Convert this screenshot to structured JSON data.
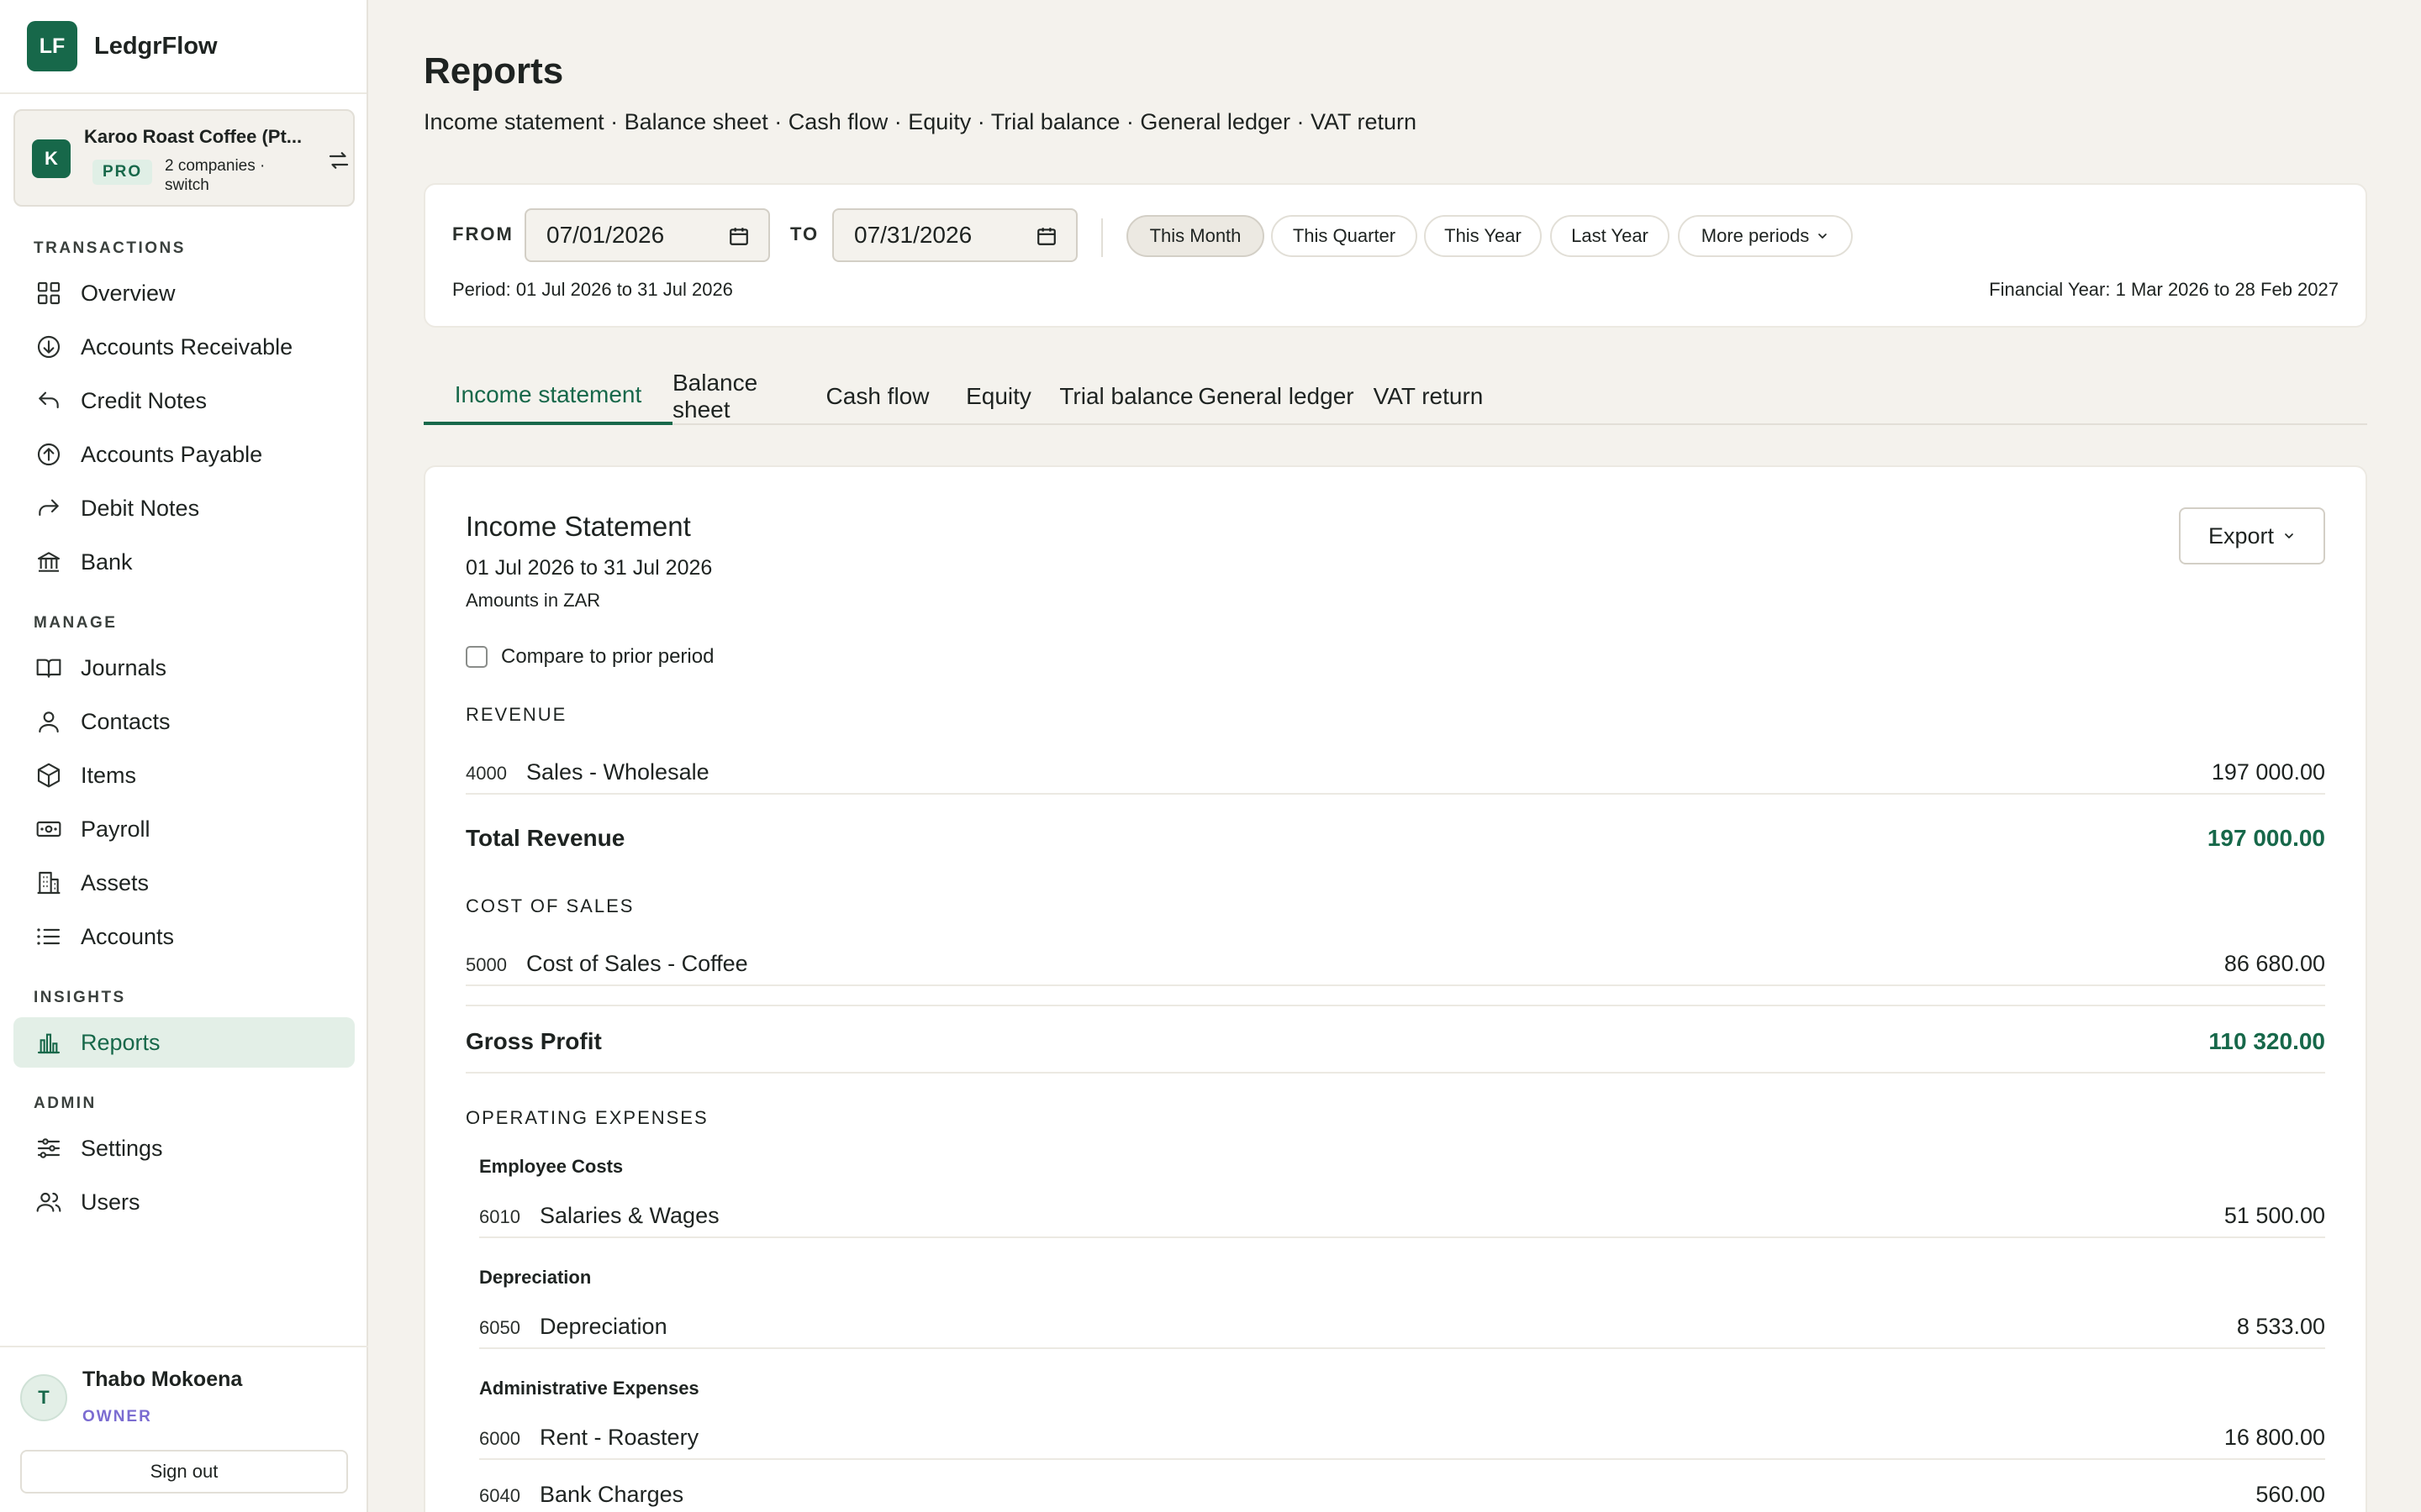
{
  "brand": {
    "logo": "LF",
    "name": "LedgrFlow"
  },
  "company": {
    "avatar": "K",
    "name": "Karoo Roast Coffee (Pt...",
    "plan": "PRO",
    "sub": "2 companies · switch",
    "icon": "switch-arrows-icon"
  },
  "nav": {
    "sections": {
      "transactions": "TRANSACTIONS",
      "manage": "MANAGE",
      "insights": "INSIGHTS",
      "admin": "ADMIN"
    },
    "items": [
      {
        "label": "Overview",
        "icon": "grid-icon"
      },
      {
        "label": "Accounts Receivable",
        "icon": "arrow-down-circle-icon"
      },
      {
        "label": "Credit Notes",
        "icon": "undo-arrow-icon"
      },
      {
        "label": "Accounts Payable",
        "icon": "arrow-up-circle-icon"
      },
      {
        "label": "Debit Notes",
        "icon": "redo-arrow-icon"
      },
      {
        "label": "Bank",
        "icon": "bank-icon"
      },
      {
        "label": "Journals",
        "icon": "book-icon"
      },
      {
        "label": "Contacts",
        "icon": "person-icon"
      },
      {
        "label": "Items",
        "icon": "box-icon"
      },
      {
        "label": "Payroll",
        "icon": "banknote-icon"
      },
      {
        "label": "Assets",
        "icon": "building-icon"
      },
      {
        "label": "Accounts",
        "icon": "list-icon"
      },
      {
        "label": "Reports",
        "icon": "bar-chart-icon",
        "active": true
      },
      {
        "label": "Settings",
        "icon": "sliders-icon"
      },
      {
        "label": "Users",
        "icon": "users-icon"
      }
    ]
  },
  "user": {
    "initial": "T",
    "name": "Thabo Mokoena",
    "role": "OWNER",
    "signout": "Sign out"
  },
  "page": {
    "title": "Reports",
    "subtitle": "Income statement · Balance sheet · Cash flow · Equity · Trial balance · General ledger · VAT return"
  },
  "filters": {
    "from_label": "FROM",
    "from_value": "07/01/2026",
    "to_label": "TO",
    "to_value": "07/31/2026",
    "chips": [
      "This Month",
      "This Quarter",
      "This Year",
      "Last Year",
      "More periods"
    ],
    "period": "Period: 01 Jul 2026 to 31 Jul 2026",
    "financial_year": "Financial Year: 1 Mar 2026 to 28 Feb 2027"
  },
  "tabs": [
    "Income statement",
    "Balance sheet",
    "Cash flow",
    "Equity",
    "Trial balance",
    "General ledger",
    "VAT return"
  ],
  "report": {
    "title": "Income Statement",
    "dates": "01 Jul 2026 to 31 Jul 2026",
    "currency": "Amounts in ZAR",
    "export": "Export",
    "compare": "Compare to prior period",
    "revenue_head": "REVENUE",
    "revenue_lines": [
      {
        "code": "4000",
        "name": "Sales - Wholesale",
        "amount": "197 000.00"
      }
    ],
    "total_revenue": {
      "name": "Total Revenue",
      "amount": "197 000.00"
    },
    "cos_head": "COST OF SALES",
    "cos_lines": [
      {
        "code": "5000",
        "name": "Cost of Sales - Coffee",
        "amount": "86 680.00"
      }
    ],
    "gross_profit": {
      "name": "Gross Profit",
      "amount": "110 320.00"
    },
    "opex_head": "OPERATING EXPENSES",
    "opex_groups": [
      {
        "name": "Employee Costs",
        "lines": [
          {
            "code": "6010",
            "name": "Salaries & Wages",
            "amount": "51 500.00"
          }
        ]
      },
      {
        "name": "Depreciation",
        "lines": [
          {
            "code": "6050",
            "name": "Depreciation",
            "amount": "8 533.00"
          }
        ]
      },
      {
        "name": "Administrative Expenses",
        "lines": [
          {
            "code": "6000",
            "name": "Rent - Roastery",
            "amount": "16 800.00"
          },
          {
            "code": "6040",
            "name": "Bank Charges",
            "amount": "560.00"
          }
        ]
      }
    ]
  },
  "colors": {
    "accent": "#17684a",
    "background": "#f4f2ed",
    "role": "#7b6cd1"
  }
}
